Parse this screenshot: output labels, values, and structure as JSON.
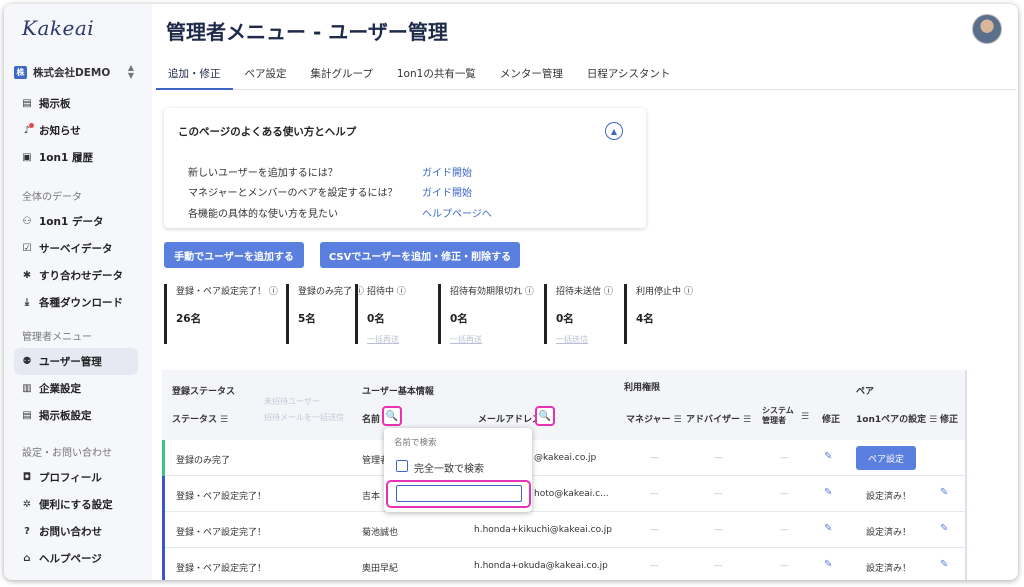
{
  "app": {
    "logo": "Kakeai",
    "company": "株式会社DEMO",
    "company_badge": "株"
  },
  "sidebar": {
    "top_items": [
      {
        "icon": "board-icon",
        "glyph": "▤",
        "label": "掲示板"
      },
      {
        "icon": "bell-icon",
        "glyph": "🔔",
        "label": "お知らせ"
      },
      {
        "icon": "history-icon",
        "glyph": "▣",
        "label": "1on1 履歴"
      }
    ],
    "section_data": "全体のデータ",
    "data_items": [
      {
        "icon": "people-icon",
        "glyph": "👥",
        "label": "1on1 データ"
      },
      {
        "icon": "survey-icon",
        "glyph": "☑",
        "label": "サーベイデータ"
      },
      {
        "icon": "puzzle-icon",
        "glyph": "✱",
        "label": "すり合わせデータ"
      },
      {
        "icon": "download-icon",
        "glyph": "⤓",
        "label": "各種ダウンロード"
      }
    ],
    "section_admin": "管理者メニュー",
    "admin_items": [
      {
        "icon": "user-manage-icon",
        "glyph": "👤",
        "label": "ユーザー管理",
        "active": true
      },
      {
        "icon": "company-icon",
        "glyph": "▥",
        "label": "企業設定"
      },
      {
        "icon": "board-settings-icon",
        "glyph": "▤",
        "label": "掲示板設定"
      }
    ],
    "section_settings": "設定・お問い合わせ",
    "settings_items": [
      {
        "icon": "profile-icon",
        "glyph": "◘",
        "label": "プロフィール"
      },
      {
        "icon": "gear-icon",
        "glyph": "✲",
        "label": "便利にする設定"
      },
      {
        "icon": "question-icon",
        "glyph": "❓",
        "label": "お問い合わせ"
      },
      {
        "icon": "graduation-icon",
        "glyph": "🎓",
        "label": "ヘルプページ"
      }
    ]
  },
  "header": {
    "title": "管理者メニュー - ユーザー管理"
  },
  "tabs": [
    {
      "label": "追加・修正",
      "active": true
    },
    {
      "label": "ペア設定"
    },
    {
      "label": "集計グループ"
    },
    {
      "label": "1on1の共有一覧"
    },
    {
      "label": "メンター管理"
    },
    {
      "label": "日程アシスタント"
    }
  ],
  "help": {
    "title": "このページのよくある使い方とヘルプ",
    "rows": [
      {
        "question": "新しいユーザーを追加するには？",
        "link": "ガイド開始"
      },
      {
        "question": "マネジャーとメンバーのペアを設定するには？",
        "link": "ガイド開始"
      },
      {
        "question": "各機能の具体的な使い方を見たい",
        "link": "ヘルプページへ"
      }
    ]
  },
  "buttons": {
    "add_manual": "手動でユーザーを追加する",
    "csv": "CSVでユーザーを追加・修正・削除する"
  },
  "stats": [
    {
      "label": "登録・ペア設定完了！ ⓘ",
      "value": "26名",
      "sub": "",
      "color": "#3e55c8"
    },
    {
      "label": "登録のみ完了 ⓘ",
      "value": "5名",
      "sub": "",
      "color": "#3fbf8a"
    },
    {
      "label": "招待中 ⓘ",
      "value": "0名",
      "sub": "一括再送",
      "color": "#f2d15a"
    },
    {
      "label": "招待有効期限切れ ⓘ",
      "value": "0名",
      "sub": "一括再送",
      "color": "#e88a8a"
    },
    {
      "label": "招待未送信 ⓘ",
      "value": "0名",
      "sub": "一括送信",
      "color": "#c9d3ec"
    },
    {
      "label": "利用停止中 ⓘ",
      "value": "4名",
      "sub": "",
      "color": "#c79a9a"
    }
  ],
  "table": {
    "group_status": "登録ステータス",
    "group_basic": "ユーザー基本情報",
    "group_rights": "利用権限",
    "group_pair": "ペア",
    "col_status": "ステータス",
    "col_add_user": "未招待ユーザー",
    "col_bulk_mail": "招待メールを一括送信",
    "col_name": "名前",
    "col_email": "メールアドレス",
    "col_manager": "マネジャー",
    "col_advisor": "アドバイザー",
    "col_sysadmin": "システム管理者",
    "col_edit": "修正",
    "col_pair_setting": "1on1ペアの設定",
    "col_pair_edit": "修正",
    "rows": [
      {
        "status": "登録のみ完了",
        "name": "管理者",
        "email": "@kakeai.co.jp",
        "manager": "—",
        "advisor": "—",
        "sysadmin": "—",
        "pair": "ペア設定",
        "pair_is_button": true,
        "bar": "#3fbf8a"
      },
      {
        "status": "登録・ペア設定完了！",
        "name": "吉本",
        "email": "hoto@kakeai.c...",
        "manager": "—",
        "advisor": "—",
        "sysadmin": "—",
        "pair": "設定済み！",
        "pair_is_button": false,
        "bar": "#3e55c8"
      },
      {
        "status": "登録・ペア設定完了！",
        "name": "菊池誠也",
        "email": "h.honda+kikuchi@kakeai.co.jp",
        "manager": "—",
        "advisor": "—",
        "sysadmin": "—",
        "pair": "設定済み！",
        "pair_is_button": false,
        "bar": "#3e55c8"
      },
      {
        "status": "登録・ペア設定完了！",
        "name": "奥田早紀",
        "email": "h.honda+okuda@kakeai.co.jp",
        "manager": "—",
        "advisor": "—",
        "sysadmin": "—",
        "pair": "設定済み！",
        "pair_is_button": false,
        "bar": "#3e55c8"
      }
    ]
  },
  "popover": {
    "label": "名前で検索",
    "exact_match": "完全一致で検索",
    "input_value": ""
  },
  "colors": {
    "accent": "#3e67c8",
    "button": "#5b7fde",
    "highlight": "#e832b5"
  }
}
